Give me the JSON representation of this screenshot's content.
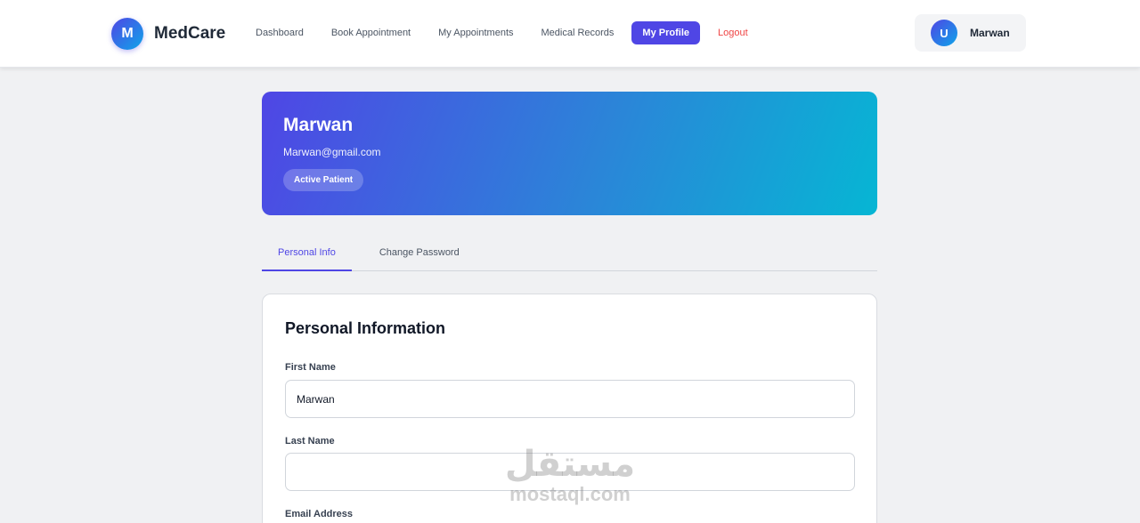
{
  "brand": {
    "logo_letter": "M",
    "name": "MedCare"
  },
  "nav": {
    "items": [
      {
        "label": "Dashboard"
      },
      {
        "label": "Book Appointment"
      },
      {
        "label": "My Appointments"
      },
      {
        "label": "Medical Records"
      },
      {
        "label": "My Profile"
      }
    ],
    "logout": "Logout",
    "active_color": "#4f46e5",
    "logout_color": "#ef4444"
  },
  "user": {
    "initial": "U",
    "name": "Marwan"
  },
  "hero": {
    "name": "Marwan",
    "email": "Marwan@gmail.com",
    "badge": "Active Patient",
    "gradient": [
      "#4f46e5",
      "#06b6d4"
    ]
  },
  "tabs": [
    {
      "label": "Personal Info"
    },
    {
      "label": "Change Password"
    }
  ],
  "form": {
    "title": "Personal Information",
    "first_name_label": "First Name",
    "first_name_value": "Marwan",
    "last_name_label": "Last Name",
    "last_name_value": "",
    "email_label": "Email Address"
  },
  "watermark": {
    "arabic": "مستقل",
    "latin": "mostaql.com"
  }
}
